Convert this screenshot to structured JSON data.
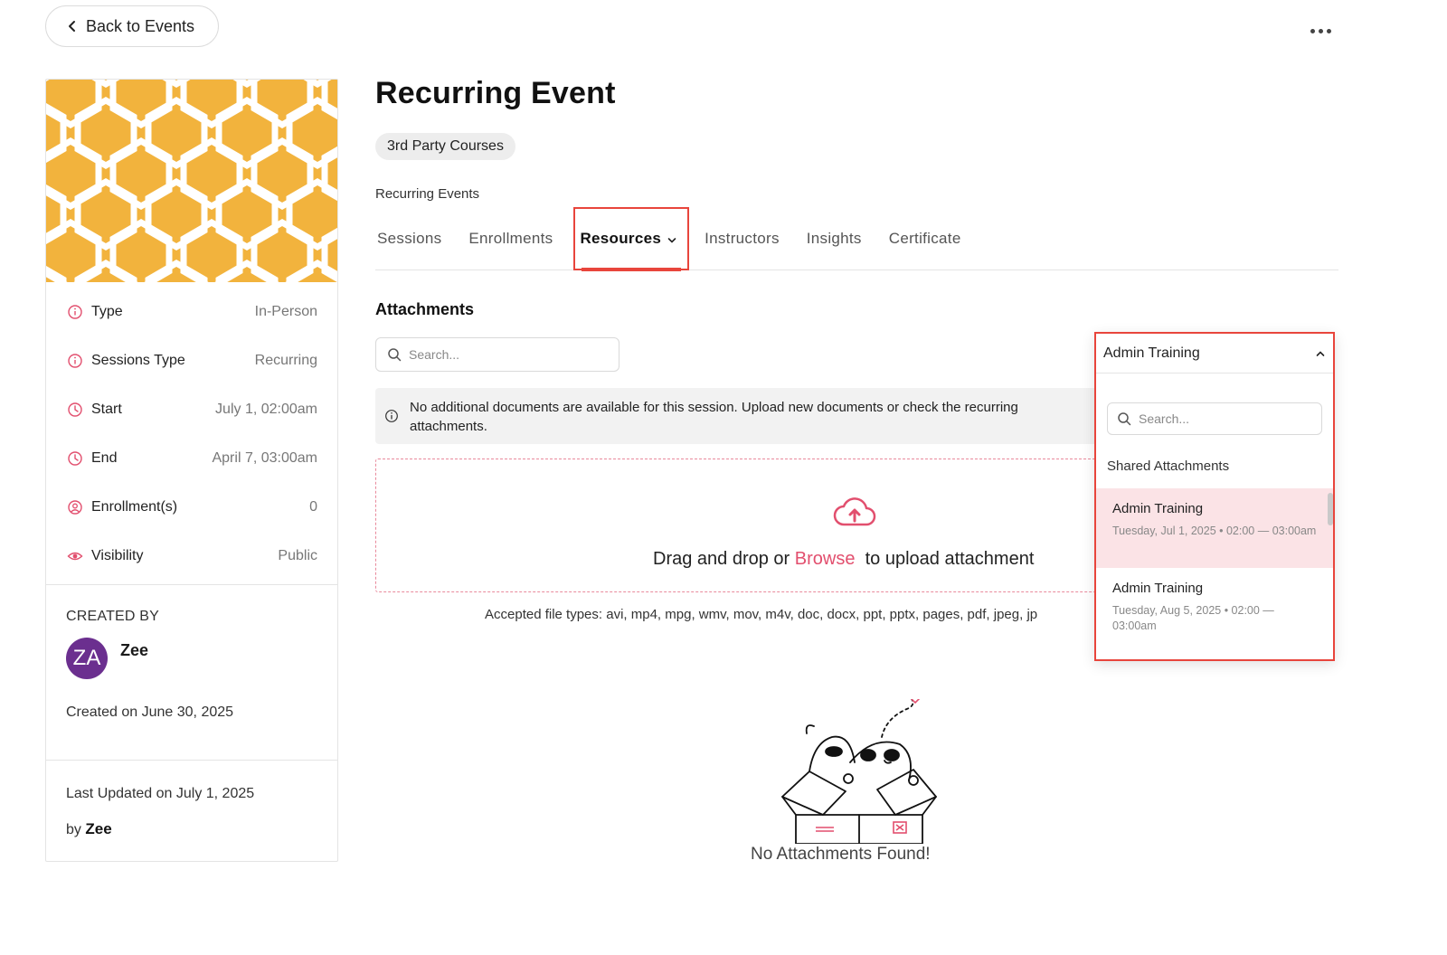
{
  "nav": {
    "back_label": "Back to Events"
  },
  "event": {
    "title": "Recurring Event",
    "category": "3rd Party Courses",
    "subtitle": "Recurring Events"
  },
  "details": [
    {
      "label": "Type",
      "value": "In-Person",
      "icon": "info-icon"
    },
    {
      "label": "Sessions Type",
      "value": "Recurring",
      "icon": "info-icon"
    },
    {
      "label": "Start",
      "value": "July 1, 02:00am",
      "icon": "clock-icon"
    },
    {
      "label": "End",
      "value": "April 7, 03:00am",
      "icon": "clock-icon"
    },
    {
      "label": "Enrollment(s)",
      "value": "0",
      "icon": "user-circle-icon"
    },
    {
      "label": "Visibility",
      "value": "Public",
      "icon": "eye-icon"
    }
  ],
  "created": {
    "header": "CREATED BY",
    "avatar_initials": "ZA",
    "name": "Zee",
    "created_on": "Created on June 30, 2025"
  },
  "updated": {
    "last_updated": "Last Updated on July 1, 2025",
    "by_prefix": "by",
    "by_name": "Zee"
  },
  "tabs": [
    {
      "label": "Sessions",
      "active": false
    },
    {
      "label": "Enrollments",
      "active": false
    },
    {
      "label": "Resources",
      "active": true
    },
    {
      "label": "Instructors",
      "active": false
    },
    {
      "label": "Insights",
      "active": false
    },
    {
      "label": "Certificate",
      "active": false
    }
  ],
  "attachments": {
    "title": "Attachments",
    "search_placeholder": "Search...",
    "notice": "No additional documents are available for this session. Upload new documents or check the recurring attachments.",
    "drop_prefix": "Drag and drop or",
    "browse": "Browse",
    "drop_suffix": "to upload attachment",
    "accepted": "Accepted file types: avi, mp4, mpg, wmv, mov, m4v, doc, docx, ppt, pptx, pages, pdf, jpeg, jp",
    "empty": "No Attachments Found!"
  },
  "session_dropdown": {
    "selected": "Admin Training",
    "search_placeholder": "Search...",
    "group_label": "Shared Attachments",
    "items": [
      {
        "title": "Admin Training",
        "subtitle": "Tuesday, Jul 1, 2025 • 02:00 — 03:00am",
        "selected": true
      },
      {
        "title": "Admin Training",
        "subtitle": "Tuesday, Aug 5, 2025 • 02:00 — 03:00am",
        "selected": false
      }
    ]
  },
  "colors": {
    "accent": "#e24f6e",
    "highlight_border": "#e8453c",
    "cover": "#f2b33d",
    "avatar": "#6b2f8f",
    "selected_row": "#fbe3e6"
  }
}
